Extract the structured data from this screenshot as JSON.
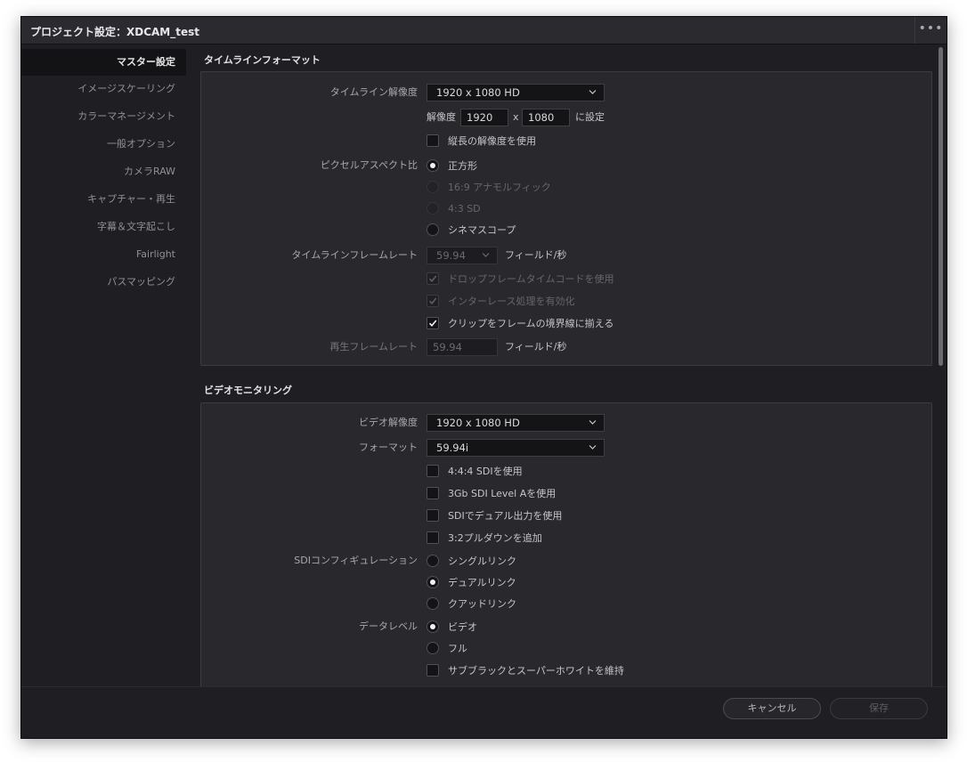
{
  "window": {
    "title": "プロジェクト設定：XDCAM_test",
    "menu_icon": "more-dots-icon"
  },
  "sidebar": {
    "items": [
      {
        "label": "マスター設定",
        "active": true
      },
      {
        "label": "イメージスケーリング"
      },
      {
        "label": "カラーマネージメント"
      },
      {
        "label": "一般オプション"
      },
      {
        "label": "カメラRAW"
      },
      {
        "label": "キャプチャー・再生"
      },
      {
        "label": "字幕＆文字起こし"
      },
      {
        "label": "Fairlight"
      },
      {
        "label": "パスマッピング"
      }
    ]
  },
  "timeline_format": {
    "section_title": "タイムラインフォーマット",
    "resolution_label": "タイムライン解像度",
    "resolution_value": "1920 x 1080 HD",
    "custom_res_label": "解像度",
    "width": "1920",
    "x_sep": "x",
    "height": "1080",
    "set_label": "に設定",
    "vertical_res_label": "縦長の解像度を使用",
    "pixel_aspect_label": "ピクセルアスペクト比",
    "pixel_aspect_options": [
      "正方形",
      "16:9 アナモルフィック",
      "4:3 SD",
      "シネマスコープ"
    ],
    "pixel_aspect_selected": "正方形",
    "frame_rate_label": "タイムラインフレームレート",
    "frame_rate_value": "59.94",
    "fields_per_sec": "フィールド/秒",
    "drop_frame_label": "ドロップフレームタイムコードを使用",
    "interlace_label": "インターレース処理を有効化",
    "clip_align_label": "クリップをフレームの境界線に揃える",
    "playback_rate_label": "再生フレームレート",
    "playback_rate_value": "59.94",
    "playback_fields_per_sec": "フィールド/秒"
  },
  "video_monitoring": {
    "section_title": "ビデオモニタリング",
    "resolution_label": "ビデオ解像度",
    "resolution_value": "1920 x 1080 HD",
    "format_label": "フォーマット",
    "format_value": "59.94i",
    "checkboxes": [
      "4:4:4 SDIを使用",
      "3Gb SDI Level Aを使用",
      "SDIでデュアル出力を使用",
      "3:2プルダウンを追加"
    ],
    "sdi_config_label": "SDIコンフィギュレーション",
    "sdi_options": [
      "シングルリンク",
      "デュアルリンク",
      "クアッドリンク"
    ],
    "sdi_selected": "デュアルリンク",
    "data_level_label": "データレベル",
    "data_level_options": [
      "ビデオ",
      "フル"
    ],
    "data_level_selected": "ビデオ",
    "retain_label": "サブブラックとスーパーホワイトを維持"
  },
  "footer": {
    "cancel_label": "キャンセル",
    "save_label": "保存"
  }
}
